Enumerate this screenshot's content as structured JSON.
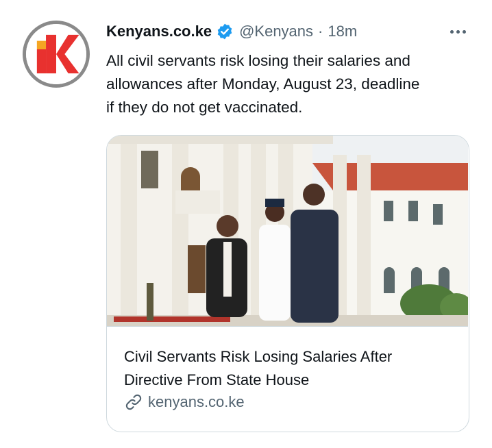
{
  "tweet": {
    "author_name": "Kenyans.co.ke",
    "author_handle": "@Kenyans",
    "separator": "·",
    "timestamp": "18m",
    "verified": true,
    "text_lines": [
      "All civil servants risk losing their salaries and",
      "allowances after Monday, August 23, deadline",
      "if they do not get vaccinated."
    ]
  },
  "card": {
    "title_lines": [
      "Civil Servants Risk Losing Salaries After",
      "Directive From State House"
    ],
    "domain": "kenyans.co.ke"
  },
  "icons": {
    "avatar": "kenyans-k-logo-icon",
    "verified": "verified-badge-icon",
    "more": "more-options-icon",
    "link": "link-icon"
  },
  "colors": {
    "brand_red": "#e8312f",
    "brand_orange": "#f5a623",
    "verified_blue": "#1d9bf0",
    "secondary_text": "#536471",
    "card_border": "#cfd9de"
  }
}
